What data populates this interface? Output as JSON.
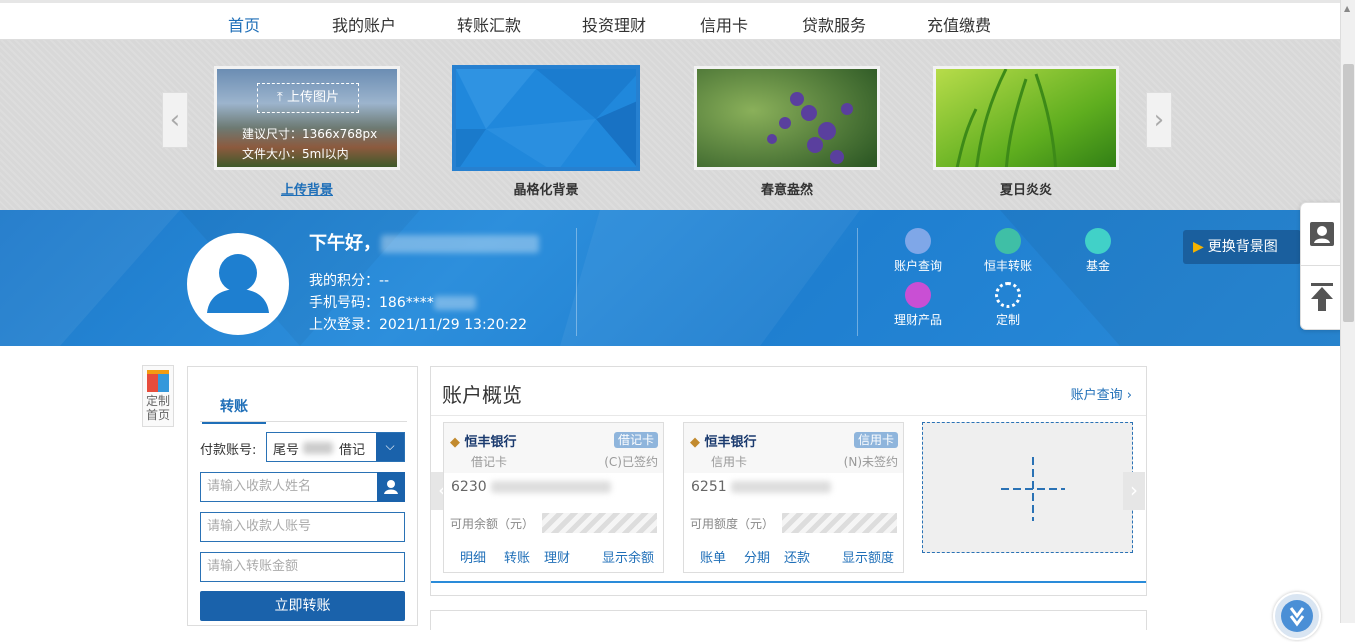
{
  "nav": {
    "items": [
      "首页",
      "我的账户",
      "转账汇款",
      "投资理财",
      "信用卡",
      "贷款服务",
      "充值缴费"
    ],
    "active_index": 0
  },
  "bg_chooser": {
    "upload_button": "上传图片",
    "size_hint": "建议尺寸：1366x768px",
    "file_hint": "文件大小：5ml以内",
    "thumbs": [
      {
        "caption": "上传背景"
      },
      {
        "caption": "晶格化背景"
      },
      {
        "caption": "春意盎然"
      },
      {
        "caption": "夏日炎炎"
      }
    ],
    "prev_arrow": "‹",
    "next_arrow": "›"
  },
  "banner": {
    "greeting": "下午好，",
    "points_label": "我的积分：--",
    "phone_label": "手机号码：186****",
    "last_login": "上次登录：2021/11/29 13:20:22",
    "quick_links": [
      {
        "label": "账户查询",
        "color": "#7fa7e8"
      },
      {
        "label": "恒丰转账",
        "color": "#3fbfa6"
      },
      {
        "label": "基金",
        "color": "#41d1c8"
      },
      {
        "label": "理财产品",
        "color": "#c94fd4"
      },
      {
        "label": "定制",
        "color": "#ffffff"
      }
    ],
    "change_bg_button": "更换背景图"
  },
  "custom_home": "定制首页",
  "transfer": {
    "tab": "转账",
    "payer_label": "付款账号:",
    "payer_value_prefix": "尾号",
    "payer_value_suffix": "借记",
    "payee_name_placeholder": "请输入收款人姓名",
    "payee_account_placeholder": "请输入收款人账号",
    "amount_placeholder": "请输入转账金额",
    "submit": "立即转账"
  },
  "overview": {
    "title": "账户概览",
    "query_link": "账户查询 ›",
    "cards": [
      {
        "bank": "恒丰银行",
        "badge": "借记卡",
        "type": "借记卡",
        "status": "(C)已签约",
        "number": "6230",
        "balance_label": "可用余额（元）",
        "actions": [
          "明细",
          "转账",
          "理财"
        ],
        "show_button": "显示余额"
      },
      {
        "bank": "恒丰银行",
        "badge": "信用卡",
        "type": "信用卡",
        "status": "(N)未签约",
        "number": "6251",
        "balance_label": "可用额度（元）",
        "actions": [
          "账单",
          "分期",
          "还款"
        ],
        "show_button": "显示额度"
      }
    ]
  },
  "colors": {
    "brand_blue": "#1f6fb8",
    "banner_blue": "#2a8bd9",
    "button_blue": "#1a62ab"
  }
}
